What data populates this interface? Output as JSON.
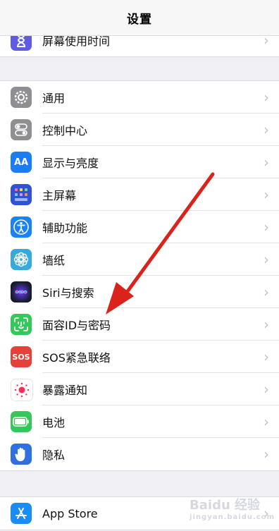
{
  "header": {
    "title": "设置"
  },
  "top_group": {
    "items": [
      {
        "label": "屏幕使用时间",
        "icon": "hourglass-icon",
        "color": "#5e5ce6"
      }
    ]
  },
  "main_group": {
    "items": [
      {
        "label": "通用",
        "icon": "gear-icon",
        "color": "#8e8e93"
      },
      {
        "label": "控制中心",
        "icon": "toggle-icon",
        "color": "#8e8e93"
      },
      {
        "label": "显示与亮度",
        "icon": "display-aa-icon",
        "color": "#1c7cf4",
        "glyph": "AA"
      },
      {
        "label": "主屏幕",
        "icon": "home-grid-icon",
        "color": "#2f52d6"
      },
      {
        "label": "辅助功能",
        "icon": "accessibility-icon",
        "color": "#1a82f2"
      },
      {
        "label": "墙纸",
        "icon": "flower-icon",
        "color": "#36aadc"
      },
      {
        "label": "Siri与搜索",
        "icon": "siri-icon",
        "color": "#1a1a2e"
      },
      {
        "label": "面容ID与密码",
        "icon": "faceid-icon",
        "color": "#34c759"
      },
      {
        "label": "SOS紧急联络",
        "icon": "sos-icon",
        "color": "#e3413a",
        "glyph": "SOS"
      },
      {
        "label": "暴露通知",
        "icon": "exposure-icon",
        "color": "#ffffff"
      },
      {
        "label": "电池",
        "icon": "battery-icon",
        "color": "#34c759"
      },
      {
        "label": "隐私",
        "icon": "hand-icon",
        "color": "#2f6fe0"
      }
    ]
  },
  "bottom_group": {
    "items": [
      {
        "label": "App Store",
        "icon": "appstore-icon",
        "color": "#1a8cf5"
      }
    ]
  },
  "chevron": "›",
  "watermark": {
    "text": "Baidu 经验",
    "sub": "jingyan.baidu.com"
  },
  "annotation": {
    "arrow_color": "#d9231b"
  }
}
